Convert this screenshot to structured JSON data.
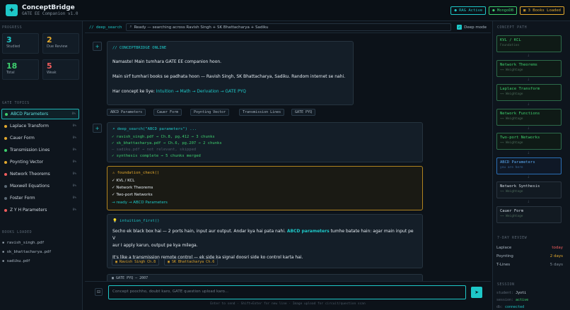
{
  "header": {
    "title": "ConceptBridge",
    "subtitle": "GATE EE Companion v1.0",
    "logo_icon": "✦",
    "badges": [
      {
        "label": "● RAG Active",
        "color": "#1ec8c8"
      },
      {
        "label": "● MongoDB",
        "color": "#3ecf6e"
      },
      {
        "label": "▣ 3 Books Loaded",
        "color": "#e3a92e"
      }
    ]
  },
  "left": {
    "progress_title": "PROGRESS",
    "stats": [
      {
        "value": "3",
        "label": "Studied",
        "color": "#1ec8c8"
      },
      {
        "value": "2",
        "label": "Due Review",
        "color": "#e3a92e"
      },
      {
        "value": "18",
        "label": "Total",
        "color": "#3ecf6e"
      },
      {
        "value": "5",
        "label": "Weak",
        "color": "#f05d5d"
      }
    ],
    "topics_title": "GATE TOPICS",
    "topics": [
      {
        "label": "ABCD Parameters",
        "count": "0%",
        "color": "#3ecf6e",
        "active": true
      },
      {
        "label": "Laplace Transform",
        "count": "0%",
        "color": "#e3a92e"
      },
      {
        "label": "Cauer Form",
        "count": "0%",
        "color": "#e3a92e"
      },
      {
        "label": "Transmission Lines",
        "count": "0%",
        "color": "#3ecf6e"
      },
      {
        "label": "Poynting Vector",
        "count": "0%",
        "color": "#e3a92e"
      },
      {
        "label": "Network Theorems",
        "count": "0%",
        "color": "#f05d5d"
      },
      {
        "label": "Maxwell Equations",
        "count": "0%",
        "color": "#5b6875"
      },
      {
        "label": "Foster Form",
        "count": "0%",
        "color": "#5b6875"
      },
      {
        "label": "Z Y H Parameters",
        "count": "0%",
        "color": "#f05d5d"
      }
    ],
    "books_title": "BOOKS LOADED",
    "books": [
      "▪ ravish_singh.pdf",
      "▪ sk_bhattacharya.pdf",
      "▪ sadiku.pdf"
    ]
  },
  "search": {
    "tag": "// deep_search",
    "status": "Ready — searching across Ravish Singh + SK Bhattacharya + Sadiku",
    "deep_label": "Deep mode"
  },
  "welcome": {
    "tag": "// CONCEPTBRIDGE ONLINE",
    "l1": "Namaste! Main tumhara GATE EE companion hoon.",
    "l2": "Main sirf tumhari books se padhata hoon — Ravish Singh, SK Bhattacharya, Sadiku. Random internet se nahi.",
    "l3a": "Har concept ke liye: ",
    "l3b": "Intuition → Math → Derivation → GATE PYQ"
  },
  "chips": [
    "ABCD Parameters",
    "Cauer Form",
    "Poynting Vector",
    "Transmission Lines",
    "GATE PYQ"
  ],
  "deep": {
    "head": "⌕ deep_search(\"ABCD parameters\") ...",
    "lines": [
      {
        "t": "✓ ravish_singh.pdf → Ch.8, pg.412 → 3 chunks",
        "c": "#3ecf6e"
      },
      {
        "t": "✓ sk_bhattacharya.pdf → Ch.6, pg.207 → 2 chunks",
        "c": "#3ecf6e"
      },
      {
        "t": "— sadiku.pdf → not relevant, skipped",
        "c": "#4d5966"
      },
      {
        "t": "✓ synthesis complete → 5 chunks merged",
        "c": "#3ecf6e"
      }
    ]
  },
  "found": {
    "head": "⚠ foundation_check()",
    "items": [
      "✓  KVL / KCL",
      "✓  Network Theorems",
      "✓  Two-port Networks"
    ],
    "ready": "→  ready → ABCD Parameters"
  },
  "intuition": {
    "head": "💡 intuition_first()",
    "p1a": "Socho ek black box hai — 2 ports hain, input aur output. Andar kya hai pata nahi. ",
    "p1b": "ABCD parameters",
    "p1c": " tumhe batate hain: agar main input pe V",
    "p1d": "aur I apply karun, output pe kya milega.",
    "p2": "It's like a transmission remote control — ek side ka signal doosri side ko control karta hai.",
    "refs": [
      "▣ Ravish Singh Ch.8",
      "▣ SK Bhattacharya Ch.6"
    ]
  },
  "peek": "▣ GATE PYQ — 2007",
  "composer": {
    "placeholder": "Concept poochho, doubt karo, GATE question upload karo...",
    "hint": "Enter to send  ·  Shift+Enter for new line  ·  Image upload for circuit/question scan",
    "send_icon": "➤",
    "attach_icon": "⊟"
  },
  "right": {
    "path_title": "CONCEPT PATH",
    "nodes": [
      {
        "t": "KVL / KCL",
        "s": "Foundation",
        "state": "done"
      },
      {
        "t": "Network Theorems",
        "s": "→→ Weightage",
        "state": "done"
      },
      {
        "t": "Laplace Transform",
        "s": "→→ Weightage",
        "state": "done"
      },
      {
        "t": "Network Functions",
        "s": "→→ Weightage",
        "state": "done"
      },
      {
        "t": "Two-port Networks",
        "s": "→→ Weightage",
        "state": "done"
      },
      {
        "t": "ABCD Parameters",
        "s": "you are here",
        "state": "current"
      },
      {
        "t": "Network Synthesis",
        "s": "→→ Weightage",
        "state": "todo"
      },
      {
        "t": "Cauer Form",
        "s": "→→ Weightage",
        "state": "todo"
      }
    ],
    "review_title": "7-DAY REVIEW",
    "review": [
      {
        "k": "Laplace",
        "v": "today",
        "c": "#f05d5d"
      },
      {
        "k": "Poynting",
        "v": "2 days",
        "c": "#e3a92e"
      },
      {
        "k": "T-Lines",
        "v": "5 days",
        "c": "#7d8a96"
      }
    ],
    "session_title": "SESSION",
    "session": [
      {
        "k": "student:",
        "v": "Jyoti",
        "c": "#c9d4de"
      },
      {
        "k": "session:",
        "v": "active",
        "c": "#3ecf6e"
      },
      {
        "k": "db:",
        "v": "connected",
        "c": "#1ec8c8"
      }
    ]
  }
}
